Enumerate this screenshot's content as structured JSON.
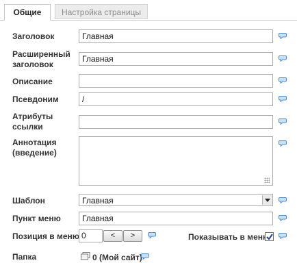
{
  "tabs": [
    {
      "label": "Общие",
      "active": true
    },
    {
      "label": "Настройка страницы",
      "active": false
    }
  ],
  "form": {
    "title_label": "Заголовок",
    "title_value": "Главная",
    "ext_title_label_1": "Расширенный",
    "ext_title_label_2": "заголовок",
    "ext_title_value": "Главная",
    "description_label": "Описание",
    "description_value": "",
    "alias_label": "Псевдоним",
    "alias_value": "/",
    "link_attr_label_1": "Атрибуты",
    "link_attr_label_2": "ссылки",
    "link_attr_value": "",
    "annotation_label_1": "Аннотация",
    "annotation_label_2": "(введение)",
    "annotation_value": "",
    "template_label": "Шаблон",
    "template_value": "Главная",
    "menu_item_label": "Пункт меню",
    "menu_item_value": "Главная",
    "menu_pos_label": "Позиция в меню",
    "menu_pos_value": "0",
    "prev_button": "<",
    "next_button": ">",
    "show_in_menu_label": "Показывать в меню",
    "show_in_menu_checked": true,
    "folder_label": "Папка",
    "folder_value": "0 (Мой сайт)"
  },
  "icons": {
    "comment": "speech-bubble-icon",
    "folder": "folder-icon",
    "checkmark": "checkmark-icon"
  },
  "colors": {
    "bubble_fill": "#c7e0f4",
    "bubble_stroke": "#4d8fd1"
  }
}
